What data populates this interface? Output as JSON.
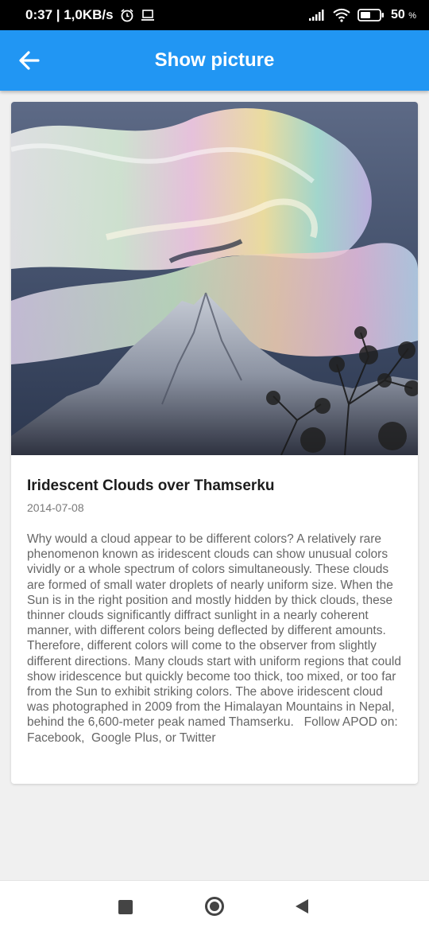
{
  "status_bar": {
    "time_speed": "0:37 | 1,0KB/s",
    "battery_percent": "50",
    "battery_unit": "%"
  },
  "app_bar": {
    "title": "Show picture",
    "back_icon": "arrow-left-icon",
    "color": "#2196f3"
  },
  "card": {
    "title": "Iridescent Clouds over Thamserku",
    "date": "2014-07-08",
    "body": "Why would a cloud appear to be different colors? A relatively rare phenomenon known as iridescent clouds can show unusual colors vividly or a whole spectrum of colors simultaneously. These clouds are formed of small water droplets of nearly uniform size. When the Sun is in the right position and mostly hidden by thick clouds, these thinner clouds significantly diffract sunlight in a nearly coherent manner, with different colors being deflected by different amounts. Therefore, different colors will come to the observer from slightly different directions. Many clouds start with uniform regions that could show iridescence but quickly become too thick, too mixed, or too far from the Sun to exhibit striking colors. The above iridescent cloud was photographed in 2009 from the Himalayan Mountains in Nepal, behind the 6,600-meter peak named Thamserku.   Follow APOD on: Facebook,  Google Plus, or Twitter"
  },
  "nav_bar": {
    "recent_icon": "square-icon",
    "home_icon": "circle-icon",
    "back_icon": "triangle-back-icon"
  }
}
